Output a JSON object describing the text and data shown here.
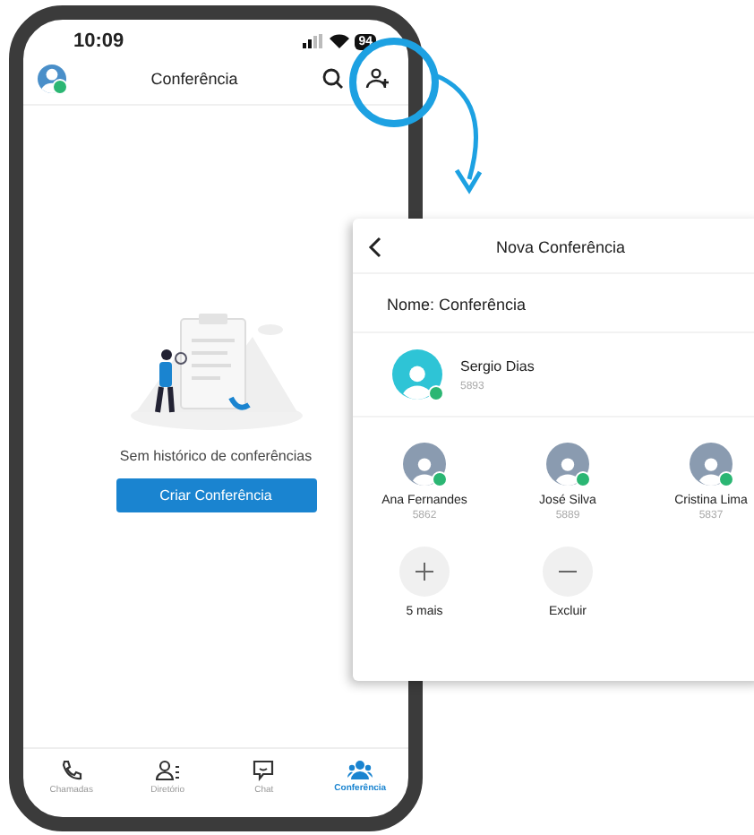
{
  "status_bar": {
    "time": "10:09",
    "battery": "94"
  },
  "header": {
    "title": "Conferência"
  },
  "empty_state": {
    "message": "Sem histórico de conferências",
    "button": "Criar Conferência"
  },
  "tabs": [
    {
      "kind": "calls",
      "label": "Chamadas",
      "selected": false
    },
    {
      "kind": "directory",
      "label": "Diretório",
      "selected": false
    },
    {
      "kind": "chat",
      "label": "Chat",
      "selected": false
    },
    {
      "kind": "conference",
      "label": "Conferência",
      "selected": true
    }
  ],
  "popup": {
    "title": "Nova Conferência",
    "name_field": "Nome: Conferência",
    "host": {
      "name": "Sergio Dias",
      "extension": "5893"
    },
    "participants": [
      {
        "name": "Ana Fernandes",
        "extension": "5862"
      },
      {
        "name": "José Silva",
        "extension": "5889"
      },
      {
        "name": "Cristina Lima",
        "extension": "5837"
      }
    ],
    "actions": [
      {
        "kind": "add",
        "label": "5 mais"
      },
      {
        "kind": "remove",
        "label": "Excluir"
      }
    ]
  }
}
